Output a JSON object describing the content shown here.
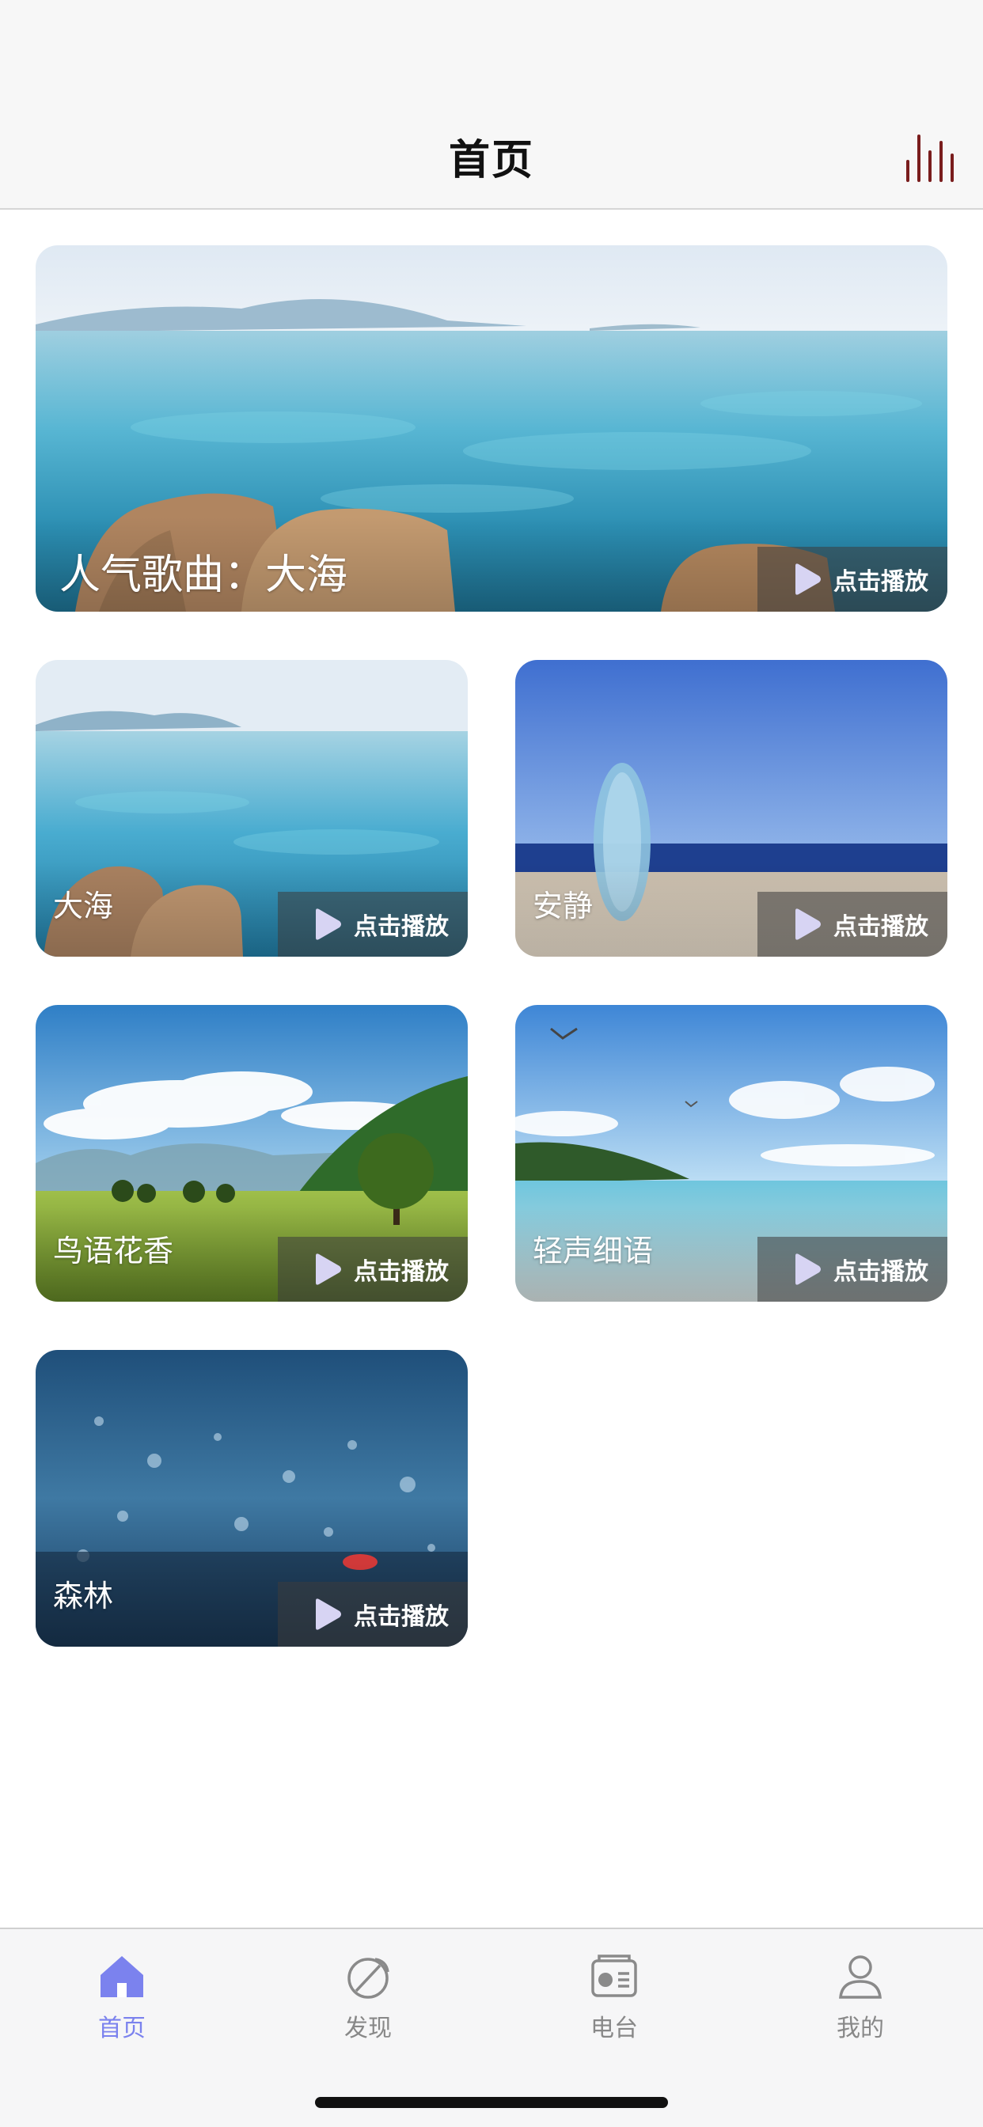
{
  "header": {
    "title": "首页",
    "icon": "equalizer-icon"
  },
  "cards": [
    {
      "title": "人气歌曲：大海",
      "play_label": "点击播放",
      "scene": "sea-rocks"
    },
    {
      "title": "大海",
      "play_label": "点击播放",
      "scene": "sea-rocks"
    },
    {
      "title": "安静",
      "play_label": "点击播放",
      "scene": "beach-surfboard"
    },
    {
      "title": "鸟语花香",
      "play_label": "点击播放",
      "scene": "meadow-tree"
    },
    {
      "title": "轻声细语",
      "play_label": "点击播放",
      "scene": "seagull-coast"
    },
    {
      "title": "森林",
      "play_label": "点击播放",
      "scene": "blue-bokeh"
    }
  ],
  "tabbar": {
    "items": [
      {
        "label": "首页",
        "icon": "home-icon",
        "active": true
      },
      {
        "label": "发现",
        "icon": "discover-icon",
        "active": false
      },
      {
        "label": "电台",
        "icon": "radio-icon",
        "active": false
      },
      {
        "label": "我的",
        "icon": "user-icon",
        "active": false
      }
    ]
  },
  "colors": {
    "accent": "#7b82ee",
    "header_bars": "#7a1d1d",
    "inactive": "#888888"
  }
}
